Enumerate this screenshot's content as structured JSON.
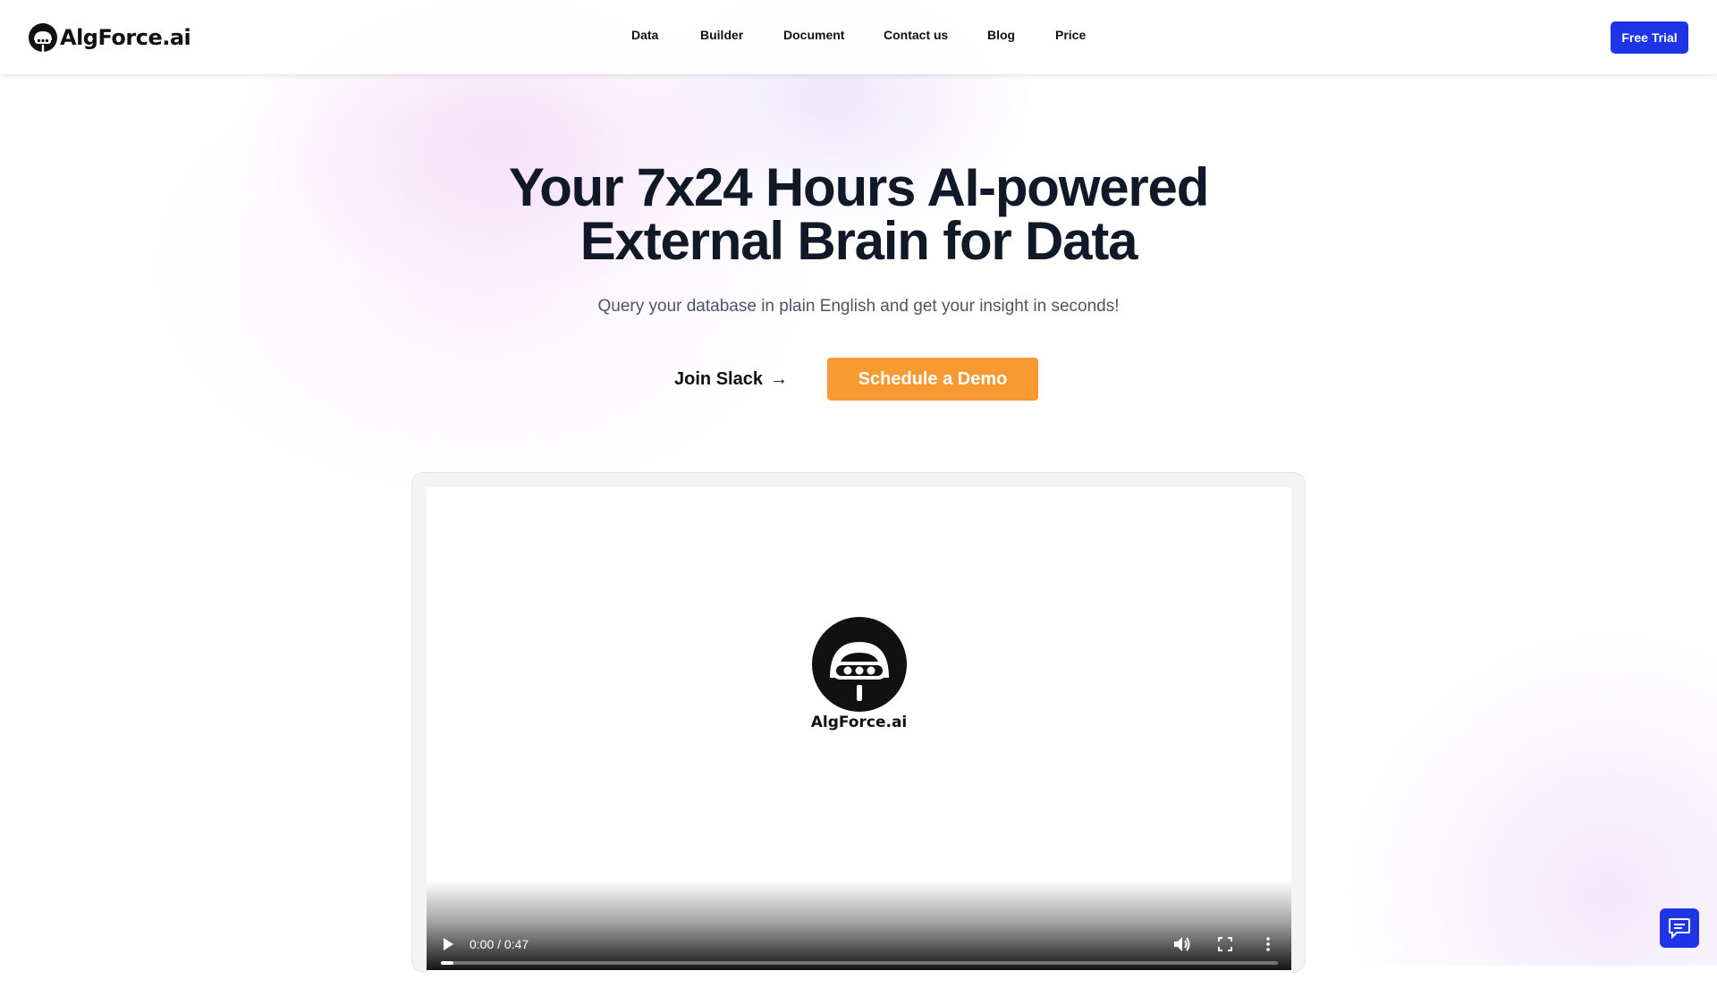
{
  "brand": {
    "name": "AlgForce.ai",
    "icon": "algforce-logo-icon"
  },
  "nav": {
    "items": [
      {
        "label": "Data"
      },
      {
        "label": "Builder"
      },
      {
        "label": "Document"
      },
      {
        "label": "Contact us"
      },
      {
        "label": "Blog"
      },
      {
        "label": "Price"
      }
    ],
    "cta": "Free Trial"
  },
  "hero": {
    "title_line1": "Your 7x24 Hours AI-powered",
    "title_line2": "External Brain for Data",
    "subtitle": "Query your database in plain English and get your insight in seconds!",
    "join_label": "Join Slack",
    "join_arrow": "→",
    "demo_label": "Schedule a Demo"
  },
  "video": {
    "logo_text": "AlgForce.ai",
    "time": "0:00 / 0:47",
    "progress": 0.015,
    "controls": [
      "play-icon",
      "volume-icon",
      "fullscreen-icon",
      "more-options-icon"
    ]
  },
  "chat": {
    "icon": "chat-icon"
  },
  "colors": {
    "primary": "#1d35e6",
    "accent": "#f89a31",
    "heading": "#111827",
    "muted": "#4b5563"
  }
}
